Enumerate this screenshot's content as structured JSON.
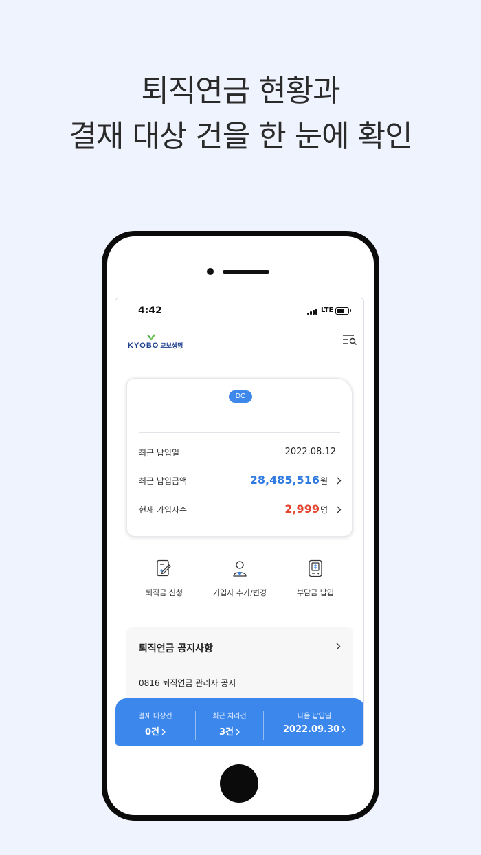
{
  "headline": {
    "line1": "퇴직연금 현황과",
    "line2": "결재 대상 건을 한 눈에 확인"
  },
  "status_bar": {
    "time": "4:42",
    "network": "LTE"
  },
  "header": {
    "logo_en": "KYOBO",
    "logo_kr": "교보생명",
    "menu_icon": "menu-search-icon"
  },
  "summary_card": {
    "badge": "DC",
    "rows": [
      {
        "label": "최근 납입일",
        "value": "2022.08.12"
      },
      {
        "label": "최근 납입금액",
        "value": "28,485,516",
        "unit": "원"
      },
      {
        "label": "현재 가입자수",
        "value": "2,999",
        "unit": "명"
      }
    ]
  },
  "quick_menu": [
    {
      "label": "퇴직금 신청",
      "icon": "document-edit-icon"
    },
    {
      "label": "가입자 추가/변경",
      "icon": "user-add-icon"
    },
    {
      "label": "부담금 납입",
      "icon": "payment-icon"
    }
  ],
  "notice": {
    "title": "퇴직연금 공지사항",
    "items": [
      "0816 퇴직연금 관리자 공지"
    ]
  },
  "bottom_bar": [
    {
      "label": "결재 대상건",
      "value": "0건"
    },
    {
      "label": "최근 처리건",
      "value": "3건"
    },
    {
      "label": "다음 납입일",
      "value": "2022.09.30"
    }
  ],
  "colors": {
    "background": "#eef3fd",
    "accent_blue": "#2f7ae0",
    "accent_red": "#e24530",
    "bottom_bar": "#3b87ec"
  }
}
